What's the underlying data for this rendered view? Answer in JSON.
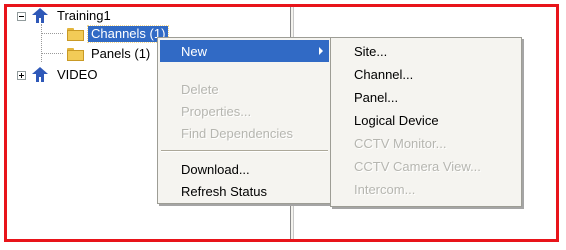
{
  "tree": {
    "root_label": "Training1",
    "channels_label": "Channels (1)",
    "panels_label": "Panels (1)",
    "video_label": "VIDEO"
  },
  "context_menu": {
    "new_label": "New",
    "delete_label": "Delete",
    "properties_label": "Properties...",
    "find_dependencies_label": "Find Dependencies",
    "download_label": "Download...",
    "refresh_status_label": "Refresh Status"
  },
  "new_submenu": {
    "site_label": "Site...",
    "channel_label": "Channel...",
    "panel_label": "Panel...",
    "logical_device_label": "Logical Device",
    "cctv_monitor_label": "CCTV Monitor...",
    "cctv_camera_view_label": "CCTV Camera View...",
    "intercom_label": "Intercom..."
  },
  "colors": {
    "frame_border": "#e8141a",
    "selection": "#316ac5",
    "menu_background": "#f5f4f0",
    "disabled_text": "#b6b6b0"
  }
}
